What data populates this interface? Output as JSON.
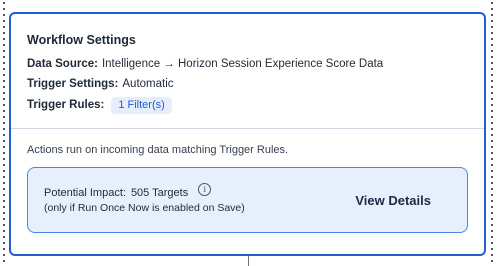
{
  "workflow_settings": {
    "title": "Workflow Settings",
    "data_source": {
      "label": "Data Source:",
      "value": "Intelligence → Horizon Session Experience Score Data"
    },
    "trigger_settings": {
      "label": "Trigger Settings:",
      "value": "Automatic"
    },
    "trigger_rules": {
      "label": "Trigger Rules:",
      "value": "1 Filter(s)"
    }
  },
  "actions": {
    "description": "Actions run on incoming data matching Trigger Rules.",
    "impact": {
      "label": "Potential Impact:",
      "targets": "505 Targets",
      "info_icon": "i",
      "note": "(only if Run Once Now is enabled on Save)",
      "view_details_label": "View Details"
    }
  },
  "colors": {
    "accent": "#1f5fd1",
    "impact_bg": "#e7effd",
    "pill_bg": "#e6eefc"
  },
  "icons": {
    "info": "info-icon"
  }
}
